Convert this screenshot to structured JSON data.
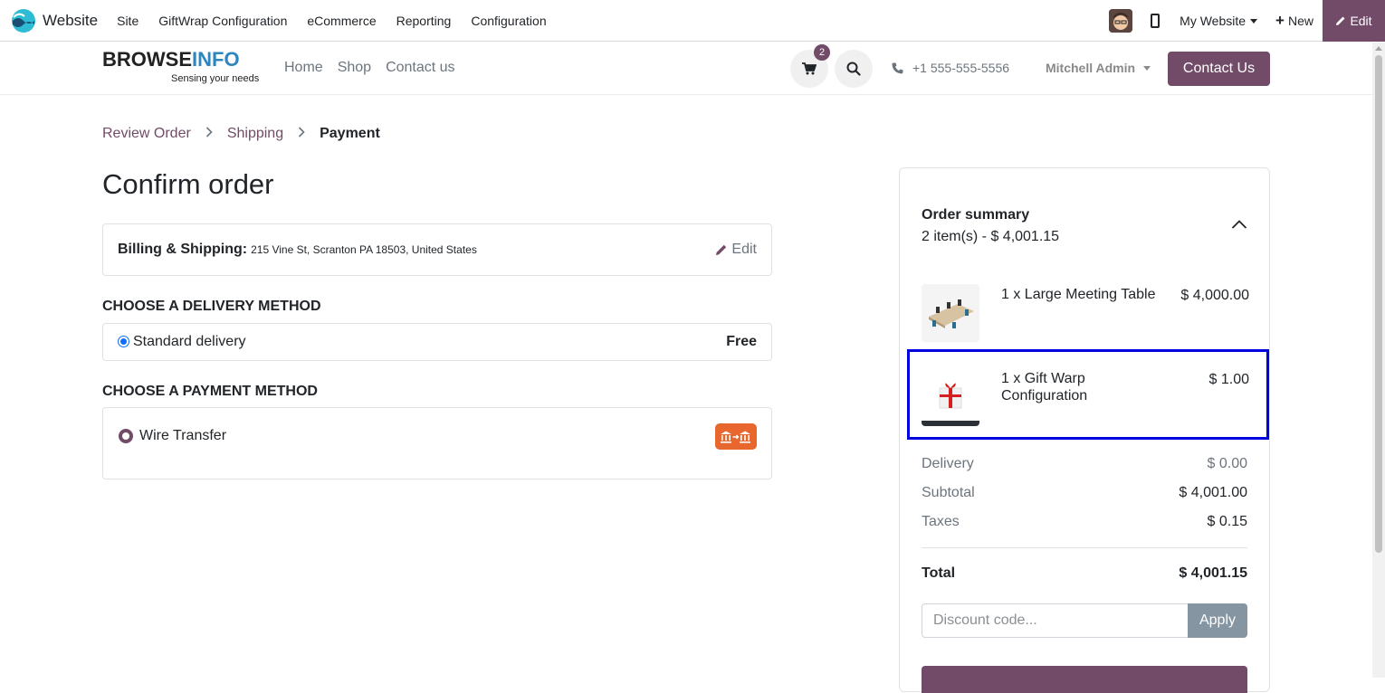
{
  "adminbar": {
    "app_name": "Website",
    "menu": [
      "Site",
      "GiftWrap Configuration",
      "eCommerce",
      "Reporting",
      "Configuration"
    ],
    "my_website": "My Website",
    "new_label": "New",
    "edit_label": "Edit"
  },
  "header": {
    "logo_main_a": "BROWSE",
    "logo_main_b": "INFO",
    "logo_tagline": "Sensing your needs",
    "nav": [
      "Home",
      "Shop",
      "Contact us"
    ],
    "cart_count": "2",
    "phone": "+1 555-555-5556",
    "user": "Mitchell Admin",
    "contact_button": "Contact Us"
  },
  "breadcrumb": {
    "step1": "Review Order",
    "step2": "Shipping",
    "step3": "Payment"
  },
  "page_title": "Confirm order",
  "billing": {
    "label": "Billing & Shipping:",
    "address": "215 Vine St, Scranton PA 18503, United States",
    "edit": "Edit"
  },
  "delivery": {
    "title": "CHOOSE A DELIVERY METHOD",
    "method": "Standard delivery",
    "price": "Free"
  },
  "payment": {
    "title": "CHOOSE A PAYMENT METHOD",
    "method": "Wire Transfer",
    "icon": "bank-transfer-icon"
  },
  "summary": {
    "title": "Order summary",
    "count": "2 item(s) -  $ 4,001.15",
    "items": [
      {
        "name": "1 x Large Meeting Table",
        "price": "$ 4,000.00"
      },
      {
        "name": "1 x Gift Warp Configuration",
        "price": "$ 1.00"
      }
    ],
    "delivery_label": "Delivery",
    "delivery_value": "$ 0.00",
    "subtotal_label": "Subtotal",
    "subtotal_value": "$ 4,001.00",
    "taxes_label": "Taxes",
    "taxes_value": "$ 0.15",
    "total_label": "Total",
    "total_value": "$ 4,001.15",
    "discount_placeholder": "Discount code...",
    "apply": "Apply"
  },
  "colors": {
    "brand": "#714b67",
    "highlight": "#0000e0",
    "wire_icon": "#e8672f"
  }
}
